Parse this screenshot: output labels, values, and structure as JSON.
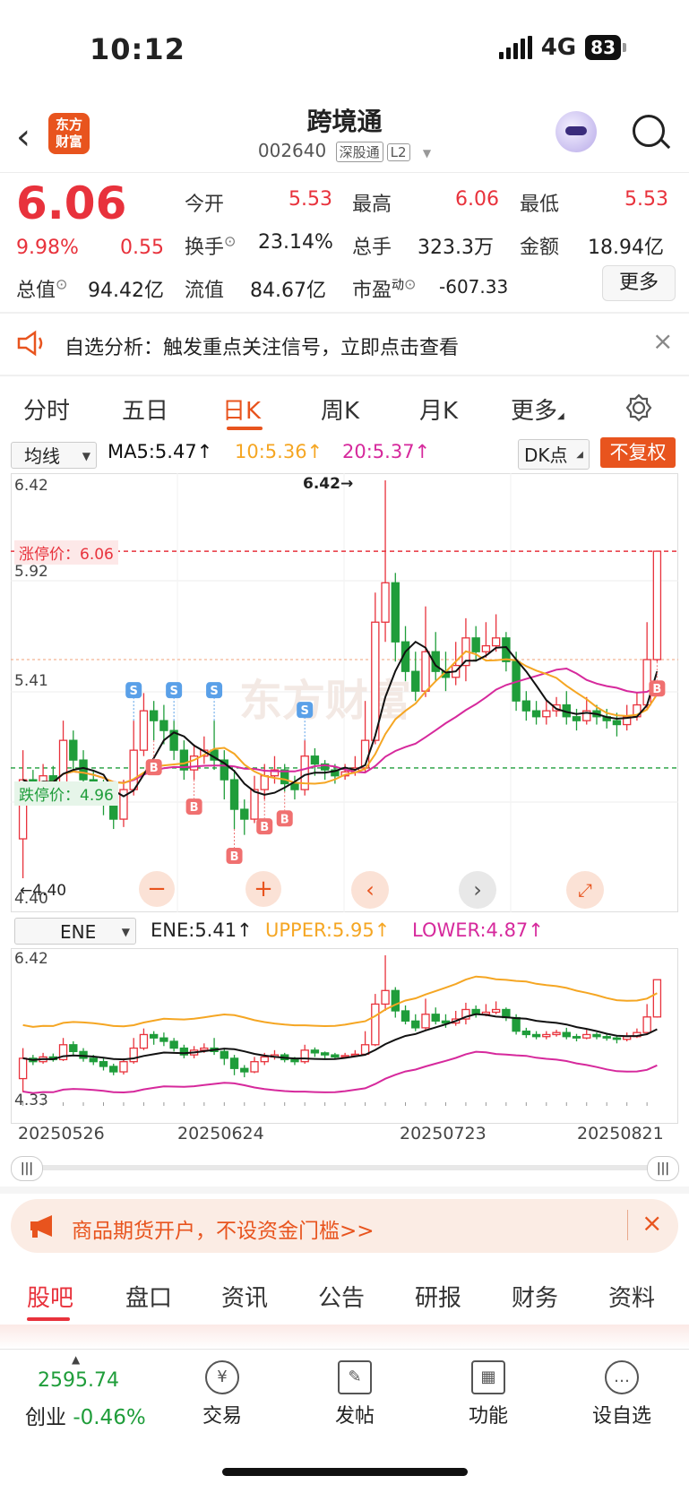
{
  "status": {
    "time": "10:12",
    "network": "4G",
    "battery": "83"
  },
  "nav": {
    "title": "跨境通",
    "code": "002640",
    "tag1": "深股通",
    "tag2": "L2",
    "logo_line1": "东方",
    "logo_line2": "财富",
    "back": "‹"
  },
  "quote": {
    "price": "6.06",
    "pct": "9.98%",
    "change": "0.55",
    "open_label": "今开",
    "open": "5.53",
    "high_label": "最高",
    "high": "6.06",
    "low_label": "最低",
    "low": "5.53",
    "turnover_label": "换手",
    "turnover": "23.14%",
    "volume_label": "总手",
    "volume": "323.3万",
    "amount_label": "金额",
    "amount": "18.94亿",
    "mktcap_label": "总值",
    "mktcap": "94.42亿",
    "float_label": "流值",
    "float": "84.67亿",
    "pe_label": "市盈",
    "pe_sup": "动",
    "pe": "-607.33",
    "more": "更多"
  },
  "banner": {
    "text": "自选分析：触发重点关注信号，立即点击查看",
    "close": "×"
  },
  "tabs": [
    "分时",
    "五日",
    "日K",
    "周K",
    "月K",
    "更多"
  ],
  "ma_row": {
    "select": "均线",
    "ma5": "MA5:5.47↑",
    "ma10": "10:5.36↑",
    "ma20": "20:5.37↑",
    "dk": "DK点",
    "fq": "不复权"
  },
  "kchart": {
    "y_top": "6.42",
    "y_mid1": "5.92",
    "y_mid2": "5.41",
    "y_bottom": "4.40",
    "high_note": "6.42→",
    "low_note": "←4.40",
    "limit_up": "涨停价：6.06",
    "limit_down": "跌停价：4.96"
  },
  "ene_row": {
    "select": "ENE",
    "ene": "ENE:5.41↑",
    "upper": "UPPER:5.95↑",
    "lower": "LOWER:4.87↑"
  },
  "enechart": {
    "y_top": "6.42",
    "y_bottom": "4.33"
  },
  "dates": [
    "20250526",
    "20250624",
    "20250723",
    "20250821"
  ],
  "colors": {
    "up": "#e8323c",
    "down": "#1f9d3a",
    "ma5": "#111111",
    "ma10": "#f5a623",
    "ma20": "#d6299c",
    "accent": "#e8541e",
    "buy_marker": "#f07070",
    "sell_marker": "#5aa0e8"
  },
  "ad": {
    "text": "商品期货开户，不设资金门槛>>",
    "close": "×"
  },
  "bottom_tabs": [
    "股吧",
    "盘口",
    "资讯",
    "公告",
    "研报",
    "财务",
    "资料"
  ],
  "footer": {
    "index_value": "2595.74",
    "index_name": "创业",
    "index_change": "-0.46%",
    "items": [
      {
        "label": "交易",
        "icon": "¥"
      },
      {
        "label": "发帖",
        "icon": "✎"
      },
      {
        "label": "功能",
        "icon": "▦"
      },
      {
        "label": "设自选",
        "icon": "…"
      }
    ]
  },
  "chart_data": {
    "type": "candlestick",
    "ylim": [
      4.4,
      6.42
    ],
    "limit_up": 6.06,
    "limit_down": 4.96,
    "x_ticks": [
      "20250526",
      "20250624",
      "20250723",
      "20250821"
    ],
    "candles": [
      [
        4.6,
        4.9,
        5.05,
        4.4
      ],
      [
        4.9,
        4.85,
        4.95,
        4.8
      ],
      [
        4.85,
        4.92,
        4.98,
        4.82
      ],
      [
        4.92,
        4.88,
        4.97,
        4.85
      ],
      [
        4.88,
        5.1,
        5.2,
        4.86
      ],
      [
        5.1,
        5.0,
        5.15,
        4.95
      ],
      [
        5.0,
        4.9,
        5.05,
        4.85
      ],
      [
        4.9,
        4.85,
        4.95,
        4.8
      ],
      [
        4.85,
        4.78,
        4.9,
        4.72
      ],
      [
        4.78,
        4.7,
        4.82,
        4.65
      ],
      [
        4.7,
        4.85,
        4.9,
        4.66
      ],
      [
        4.85,
        5.05,
        5.2,
        4.82
      ],
      [
        5.05,
        5.25,
        5.34,
        5.02
      ],
      [
        5.25,
        5.2,
        5.3,
        5.1
      ],
      [
        5.2,
        5.15,
        5.28,
        5.08
      ],
      [
        5.15,
        5.05,
        5.2,
        5.0
      ],
      [
        5.05,
        4.95,
        5.1,
        4.9
      ],
      [
        4.95,
        5.02,
        5.08,
        4.9
      ],
      [
        5.02,
        5.05,
        5.12,
        4.98
      ],
      [
        5.05,
        5.0,
        5.2,
        4.95
      ],
      [
        5.0,
        4.9,
        5.05,
        4.8
      ],
      [
        4.9,
        4.75,
        4.95,
        4.65
      ],
      [
        4.75,
        4.7,
        4.8,
        4.62
      ],
      [
        4.7,
        4.85,
        4.92,
        4.68
      ],
      [
        4.85,
        4.92,
        4.98,
        4.8
      ],
      [
        4.92,
        4.95,
        5.02,
        4.88
      ],
      [
        4.95,
        4.88,
        4.98,
        4.84
      ],
      [
        4.88,
        4.85,
        4.92,
        4.8
      ],
      [
        4.85,
        5.02,
        5.1,
        4.82
      ],
      [
        5.02,
        4.98,
        5.06,
        4.92
      ],
      [
        4.98,
        4.95,
        5.0,
        4.9
      ],
      [
        4.95,
        4.92,
        4.98,
        4.88
      ],
      [
        4.92,
        4.94,
        4.98,
        4.9
      ],
      [
        4.94,
        4.96,
        5.02,
        4.92
      ],
      [
        4.96,
        5.1,
        5.3,
        4.94
      ],
      [
        5.1,
        5.7,
        5.85,
        5.08
      ],
      [
        5.7,
        5.9,
        6.42,
        5.6
      ],
      [
        5.9,
        5.6,
        5.95,
        5.5
      ],
      [
        5.6,
        5.45,
        5.68,
        5.4
      ],
      [
        5.45,
        5.35,
        5.55,
        5.3
      ],
      [
        5.35,
        5.55,
        5.78,
        5.32
      ],
      [
        5.55,
        5.45,
        5.65,
        5.4
      ],
      [
        5.45,
        5.42,
        5.55,
        5.35
      ],
      [
        5.42,
        5.48,
        5.6,
        5.38
      ],
      [
        5.48,
        5.62,
        5.72,
        5.4
      ],
      [
        5.62,
        5.55,
        5.68,
        5.5
      ],
      [
        5.55,
        5.58,
        5.7,
        5.52
      ],
      [
        5.58,
        5.62,
        5.74,
        5.55
      ],
      [
        5.62,
        5.5,
        5.65,
        5.45
      ],
      [
        5.5,
        5.3,
        5.55,
        5.25
      ],
      [
        5.3,
        5.25,
        5.35,
        5.2
      ],
      [
        5.25,
        5.22,
        5.3,
        5.18
      ],
      [
        5.22,
        5.25,
        5.3,
        5.18
      ],
      [
        5.25,
        5.28,
        5.32,
        5.22
      ],
      [
        5.28,
        5.22,
        5.35,
        5.18
      ],
      [
        5.22,
        5.2,
        5.26,
        5.15
      ],
      [
        5.2,
        5.25,
        5.32,
        5.18
      ],
      [
        5.25,
        5.22,
        5.28,
        5.18
      ],
      [
        5.22,
        5.2,
        5.26,
        5.16
      ],
      [
        5.2,
        5.18,
        5.24,
        5.12
      ],
      [
        5.18,
        5.22,
        5.28,
        5.15
      ],
      [
        5.22,
        5.28,
        5.34,
        5.2
      ],
      [
        5.28,
        5.51,
        5.7,
        5.26
      ],
      [
        5.51,
        6.06,
        6.06,
        5.5
      ]
    ],
    "markers": [
      {
        "i": 11,
        "type": "S"
      },
      {
        "i": 13,
        "type": "B"
      },
      {
        "i": 15,
        "type": "S"
      },
      {
        "i": 17,
        "type": "B"
      },
      {
        "i": 19,
        "type": "S"
      },
      {
        "i": 21,
        "type": "B"
      },
      {
        "i": 24,
        "type": "B"
      },
      {
        "i": 26,
        "type": "B"
      },
      {
        "i": 28,
        "type": "S"
      },
      {
        "i": 63,
        "type": "B"
      }
    ]
  }
}
